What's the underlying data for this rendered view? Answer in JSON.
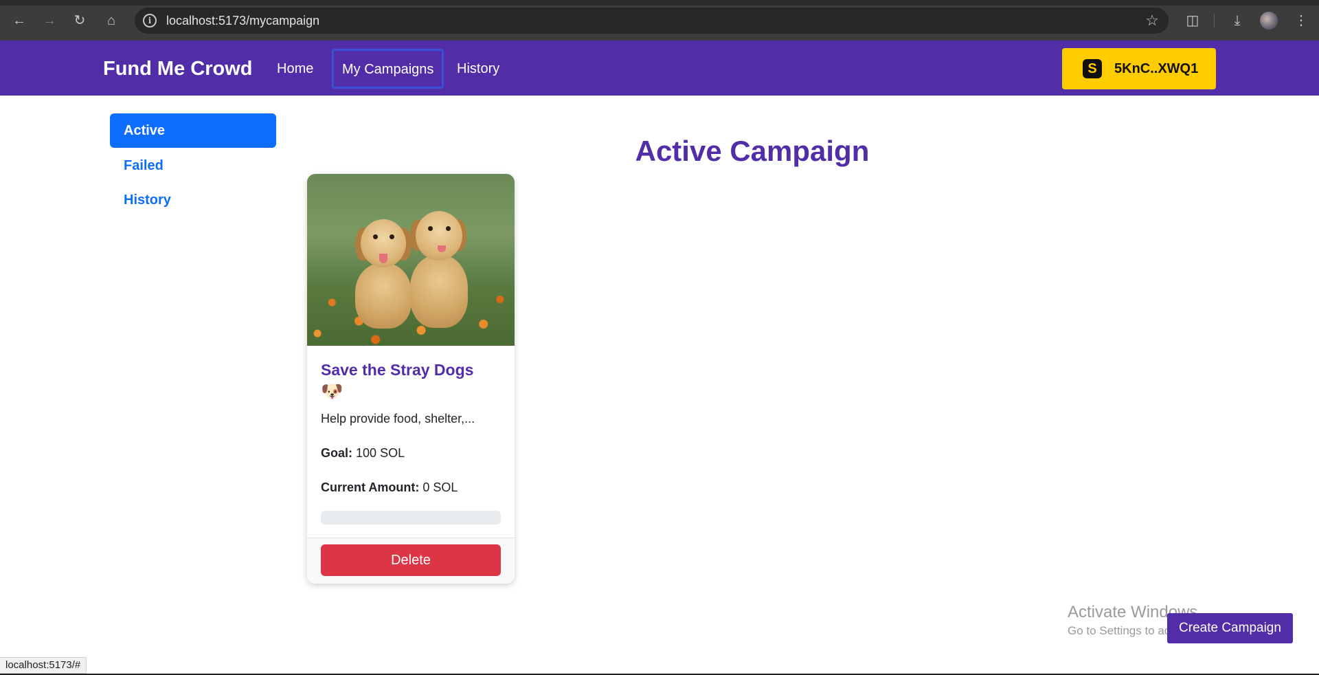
{
  "browser": {
    "url": "localhost:5173/mycampaign",
    "icons": [
      "back-icon",
      "forward-icon",
      "reload-icon",
      "home-icon",
      "site-info-icon",
      "bookmark-star-icon",
      "extensions-icon",
      "download-icon",
      "profile-avatar",
      "menu-dots-icon"
    ]
  },
  "navbar": {
    "brand": "Fund Me Crowd",
    "links": [
      "Home",
      "My Campaigns",
      "History"
    ],
    "wallet": {
      "address": "5KnC..XWQ1",
      "icon": "solana-icon"
    },
    "colors": {
      "background": "#512da8",
      "wallet": "#ffcc00"
    }
  },
  "sidebar": {
    "items": [
      {
        "label": "Active",
        "active": true
      },
      {
        "label": "Failed",
        "active": false
      },
      {
        "label": "History",
        "active": false
      }
    ]
  },
  "main": {
    "title": "Active Campaign",
    "campaigns": [
      {
        "title": "Save the Stray Dogs",
        "emoji": "🐶",
        "description": "Help provide food, shelter,...",
        "goal_label": "Goal:",
        "goal_value": "100 SOL",
        "current_label": "Current Amount:",
        "current_value": "0 SOL",
        "progress_percent": 0,
        "delete_label": "Delete"
      }
    ]
  },
  "create_button": "Create Campaign",
  "watermark": {
    "line1": "Activate Windows",
    "line2": "Go to Settings to activate Windows."
  },
  "status_bar": "localhost:5173/#"
}
